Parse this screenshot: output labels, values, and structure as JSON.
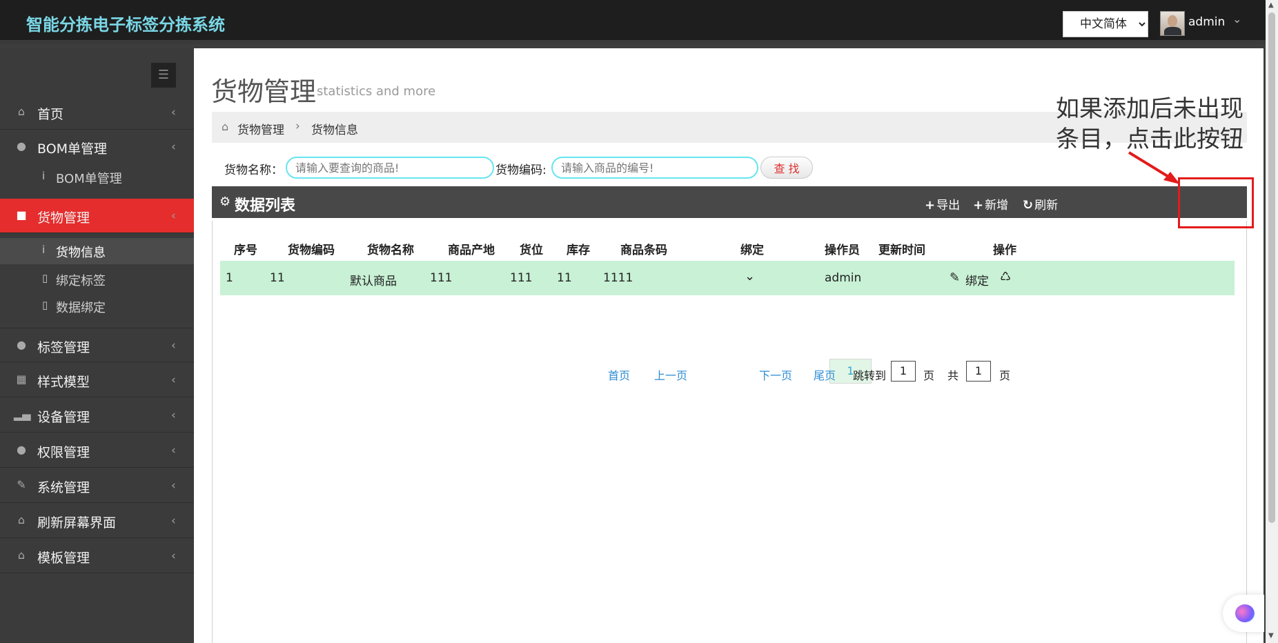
{
  "header": {
    "brand": "智能分拣电子标签分拣系统",
    "language": "中文简体",
    "user": "admin"
  },
  "sidebar": {
    "items": [
      {
        "label": "首页",
        "icon": "home-icon"
      },
      {
        "label": "BOM单管理",
        "icon": "tags-icon"
      },
      {
        "label": "BOM单管理",
        "icon": "info-icon",
        "sub": true
      },
      {
        "label": "货物管理",
        "icon": "folder-icon",
        "active": true
      },
      {
        "label": "货物信息",
        "icon": "info-icon",
        "sub": true,
        "active": true
      },
      {
        "label": "绑定标签",
        "icon": "mobile-icon",
        "sub": true
      },
      {
        "label": "数据绑定",
        "icon": "mobile-icon",
        "sub": true
      },
      {
        "label": "标签管理",
        "icon": "tags-icon"
      },
      {
        "label": "样式模型",
        "icon": "grid-icon"
      },
      {
        "label": "设备管理",
        "icon": "signal-icon"
      },
      {
        "label": "权限管理",
        "icon": "user-icon"
      },
      {
        "label": "系统管理",
        "icon": "edit-icon"
      },
      {
        "label": "刷新屏幕界面",
        "icon": "home-icon"
      },
      {
        "label": "模板管理",
        "icon": "home-icon"
      }
    ]
  },
  "page": {
    "title": "货物管理",
    "subtitle": "statistics and more",
    "breadcrumb": [
      "货物管理",
      "货物信息"
    ]
  },
  "search": {
    "name_label": "货物名称：",
    "name_placeholder": "请输入要查询的商品!",
    "code_label": "货物编码:",
    "code_placeholder": "请输入商品的编号!",
    "button": "查 找"
  },
  "panel": {
    "title": "数据列表",
    "export": "导出",
    "add": "新增",
    "refresh": "刷新"
  },
  "table": {
    "columns": [
      "序号",
      "货物编码",
      "货物名称",
      "商品产地",
      "货位",
      "库存",
      "商品条码",
      "绑定",
      "操作员",
      "更新时间",
      "操作"
    ],
    "rows": [
      {
        "index": "1",
        "code": "11",
        "name": "默认商品",
        "origin": "111",
        "location": "111",
        "stock": "11",
        "barcode": "1111",
        "operator": "admin",
        "updated": "",
        "bind_action": "绑定"
      }
    ]
  },
  "pagination": {
    "first": "首页",
    "prev": "上一页",
    "current": "1",
    "next": "下一页",
    "last": "尾页",
    "jump_label": "跳转到",
    "jump_value": "1",
    "page_unit": "页",
    "total_label": "共",
    "total_pages": "1",
    "total_unit": "页"
  },
  "annotation": {
    "text": "如果添加后未出现条目，点击此按钮"
  },
  "colors": {
    "header_bg": "#1e1e1e",
    "brand": "#7ad7e6",
    "sidebar_bg": "#3b3b3b",
    "active": "#e52d2d",
    "row_bg": "#c8f1d5",
    "annotation_red": "#e31b1b"
  }
}
